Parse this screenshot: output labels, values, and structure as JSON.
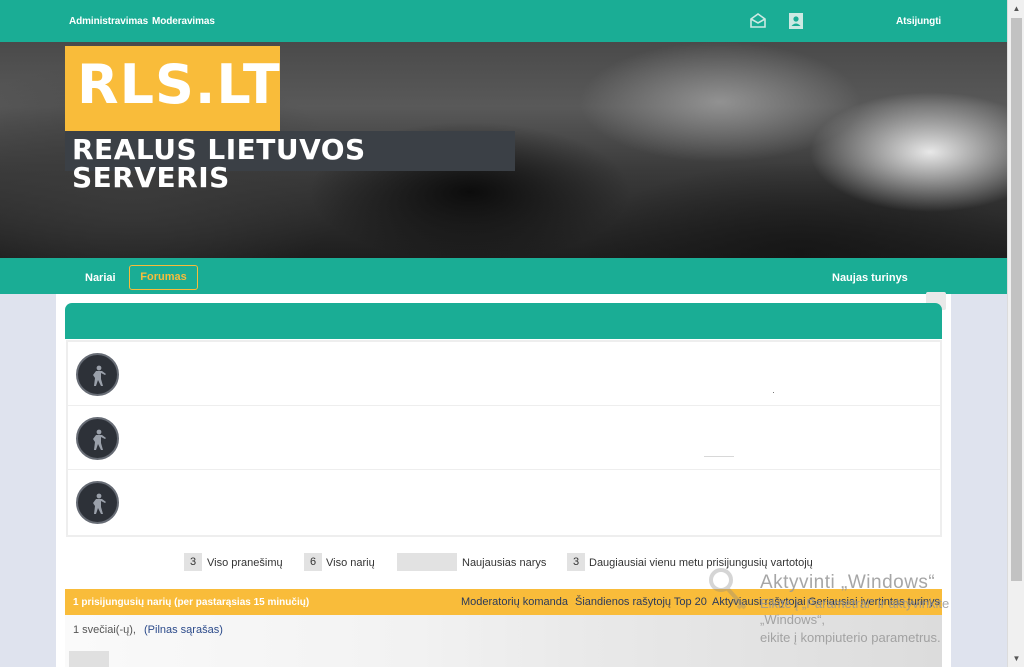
{
  "topbar": {
    "admin_label": "Administravimas",
    "moderation_label": "Moderavimas",
    "logout_label": "Atsijungti",
    "icons": [
      "envelope-icon",
      "profile-card-icon"
    ]
  },
  "banner": {
    "logo_text": "RLS.LT",
    "subtitle": "REALUS LIETUVOS SERVERIS"
  },
  "nav": {
    "members": "Nariai",
    "forum": "Forumas",
    "new_content": "Naujas turinys"
  },
  "forum": {
    "rows": [
      {
        "avatar_icon": "soldier-icon"
      },
      {
        "avatar_icon": "soldier-icon"
      },
      {
        "avatar_icon": "soldier-icon"
      }
    ]
  },
  "stats": {
    "posts_count": "3",
    "posts_label": "Viso pranešimų",
    "members_count": "6",
    "members_label": "Viso narių",
    "newest_member_label": "Naujausias narys",
    "max_online_count": "3",
    "max_online_label": "Daugiausiai vienu metu prisijungusių vartotojų"
  },
  "online": {
    "header": "1 prisijungusių narių (per pastarąsias 15 minučių)",
    "links": [
      "Moderatorių komanda",
      "Šiandienos rašytojų Top 20",
      "Aktyviausi rašytojai",
      "Geriausiai įvertintas turinys"
    ],
    "guests": "1 svečiai(-ų),",
    "full_list": "(Pilnas sąrašas)"
  },
  "watermark": {
    "title": "Aktyvinti „Windows“",
    "line1": "Eikite į „Parametrai“ ir aktyvinkite „Windows“,",
    "line2": "eikite į kompiuterio parametrus."
  },
  "colors": {
    "teal": "#1aad95",
    "yellow": "#f9bc3a",
    "dark": "#3b4046"
  }
}
